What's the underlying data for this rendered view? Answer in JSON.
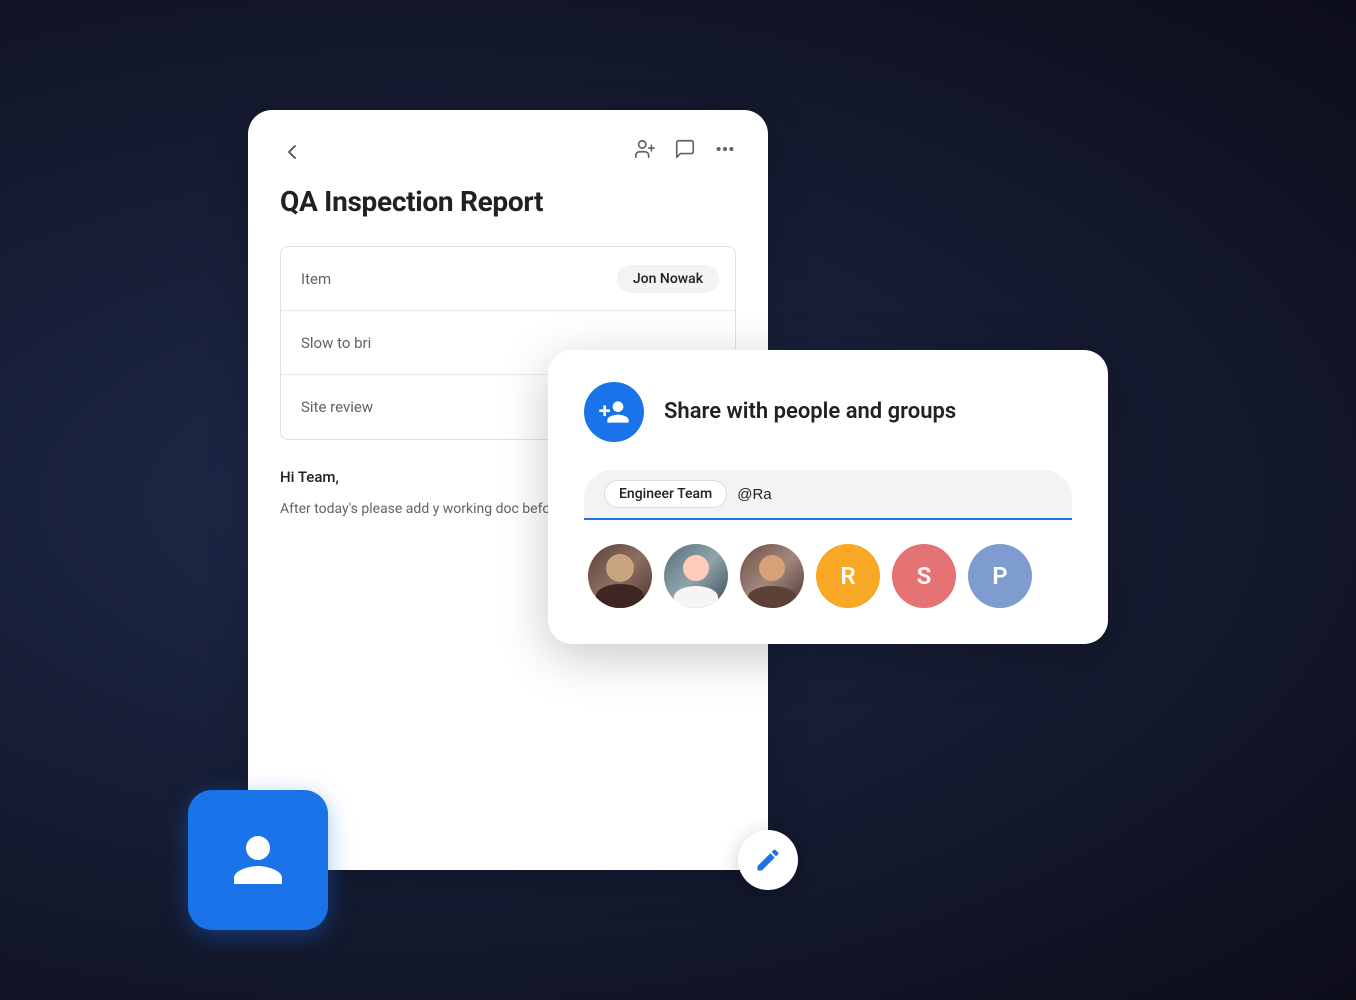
{
  "doc": {
    "title": "QA Inspection Report",
    "back_label": "←",
    "table": {
      "rows": [
        {
          "left": "Item",
          "right": "Jon Nowak"
        },
        {
          "left": "Slow to bri",
          "right": ""
        },
        {
          "left": "Site review",
          "right": ""
        }
      ]
    },
    "body": {
      "greeting": "Hi Team,",
      "text": "After today's please add y working doc before next week."
    }
  },
  "share_dialog": {
    "title": "Share with people and groups",
    "chip_label": "Engineer Team",
    "input_value": "@Ra",
    "input_placeholder": "@Ra",
    "avatars": [
      {
        "type": "photo",
        "id": "person1",
        "initial": ""
      },
      {
        "type": "photo",
        "id": "person2",
        "initial": ""
      },
      {
        "type": "photo",
        "id": "person3",
        "initial": ""
      },
      {
        "type": "letter",
        "id": "r",
        "initial": "R",
        "color": "#f9a825"
      },
      {
        "type": "letter",
        "id": "s",
        "initial": "S",
        "color": "#e57373"
      },
      {
        "type": "letter",
        "id": "p",
        "initial": "P",
        "color": "#7e9ccf"
      }
    ]
  },
  "fab": {
    "label": "Edit"
  },
  "person_card": {
    "label": "Person"
  },
  "toolbar": {
    "add_person_label": "Add person",
    "comment_label": "Comment",
    "more_label": "More options"
  }
}
